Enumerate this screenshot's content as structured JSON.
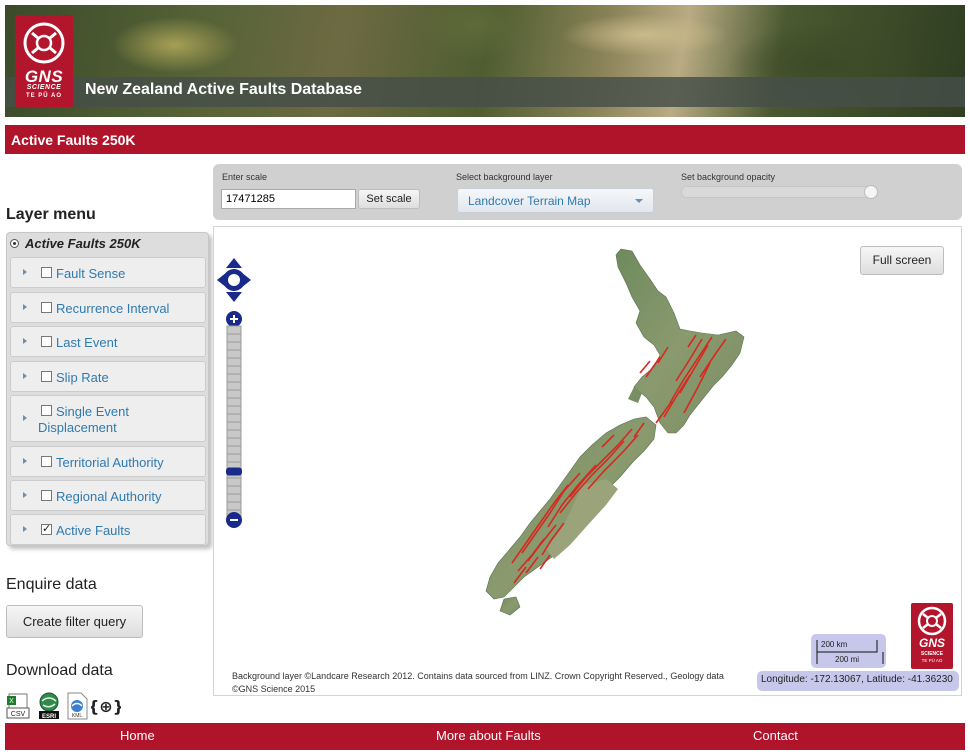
{
  "header": {
    "logo_main": "GNS",
    "logo_sub": "SCIENCE",
    "logo_tagline": "TE PŪ AO",
    "site_title": "New Zealand Active Faults Database"
  },
  "titlebar": {
    "title": "Active Faults 250K"
  },
  "layer_menu": {
    "heading": "Layer menu",
    "group": "Active Faults 250K",
    "items": [
      {
        "label": "Fault Sense",
        "checked": false
      },
      {
        "label": "Recurrence Interval",
        "checked": false
      },
      {
        "label": "Last Event",
        "checked": false
      },
      {
        "label": "Slip Rate",
        "checked": false
      },
      {
        "label": "Single Event",
        "label2": "Displacement",
        "checked": false
      },
      {
        "label": "Territorial Authority",
        "checked": false
      },
      {
        "label": "Regional Authority",
        "checked": false
      },
      {
        "label": "Active Faults",
        "checked": true
      }
    ]
  },
  "enquire": {
    "heading": "Enquire data",
    "button": "Create filter query"
  },
  "download": {
    "heading": "Download data",
    "icons": [
      "csv-icon",
      "esri-shapefile-icon",
      "kml-icon",
      "geojson-icon"
    ],
    "csv_label": "CSV",
    "esri_label": "ESRI",
    "kml_label": "KML",
    "geojson_label": "{⊕}"
  },
  "controls": {
    "scale_label": "Enter scale",
    "scale_value": "17471285",
    "set_scale": "Set scale",
    "bg_label": "Select background layer",
    "bg_value": "Landcover Terrain Map",
    "opacity_label": "Set background opacity",
    "opacity_value": 0.98
  },
  "map": {
    "fullscreen": "Full screen",
    "attribution": "Background layer ©Landcare Research 2012. Contains data sourced from LINZ. Crown Copyright Reserved., Geology data ©GNS Science 2015",
    "scale_km": "200 km",
    "scale_mi": "200 mi",
    "coordinates": "Longitude: -172.13067, Latitude: -41.36230",
    "zoom_level_fraction": 0.25
  },
  "footer": {
    "links": [
      "Home",
      "More about Faults",
      "Contact"
    ]
  },
  "colors": {
    "brand_red": "#b0142b",
    "link_blue": "#2f7ab0",
    "zoom_navy": "#1a2a8a",
    "fault_red": "#d42a20"
  }
}
